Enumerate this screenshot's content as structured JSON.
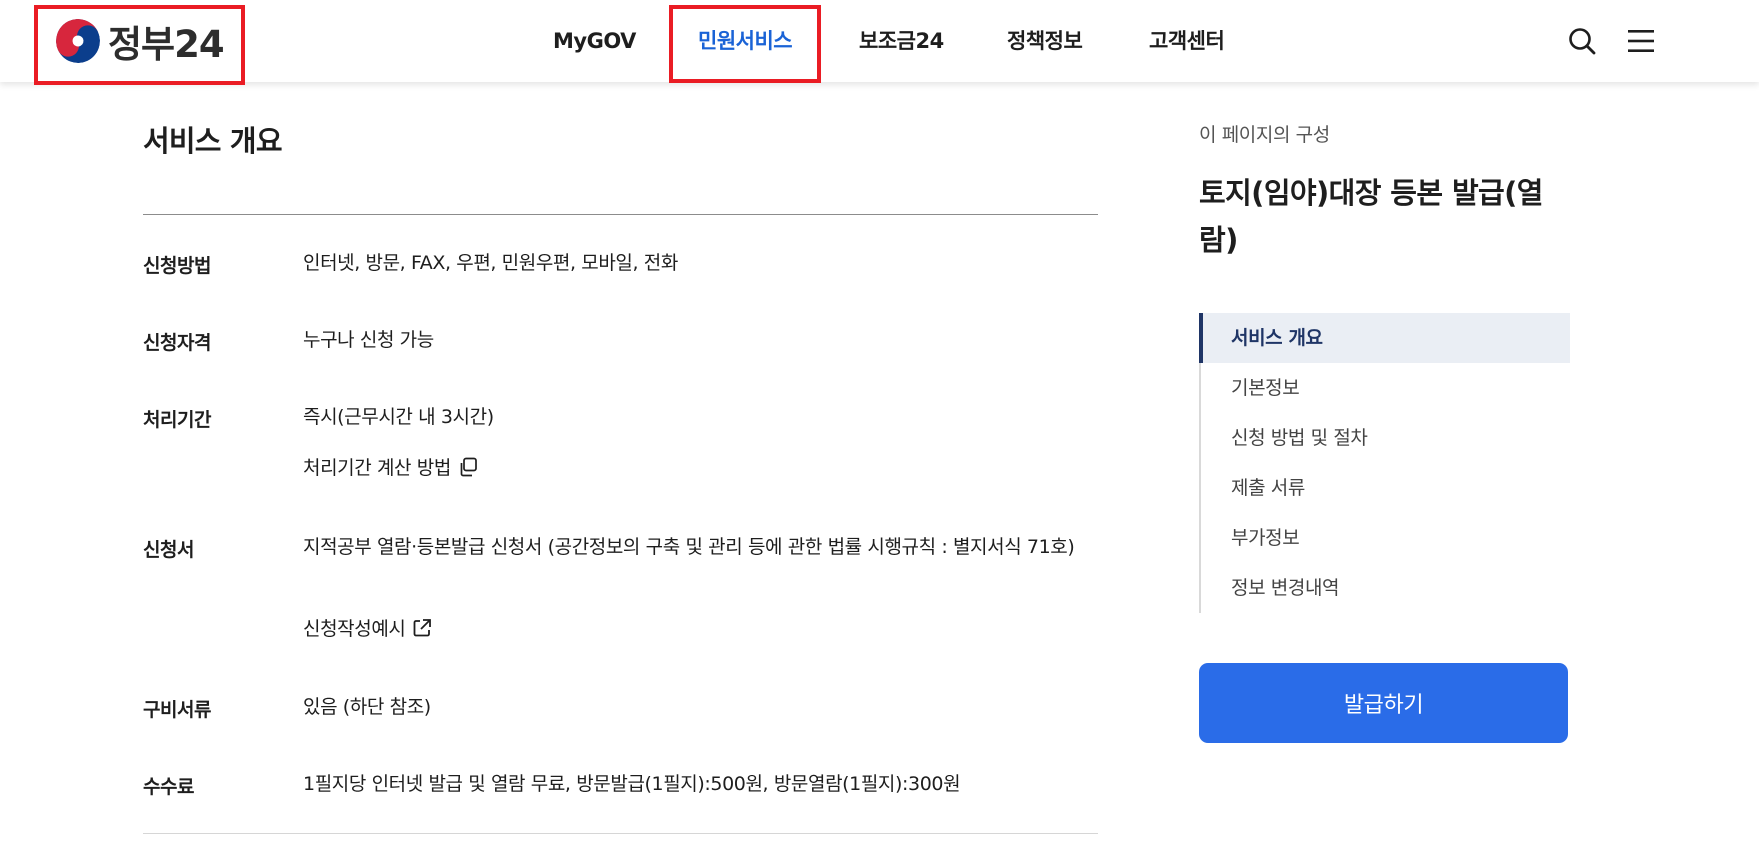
{
  "colors": {
    "accent": "#1a63d6",
    "button": "#2a6ce8",
    "highlight": "#ea1c24",
    "toc_active_bg": "#eaeef4",
    "toc_active_text": "#1f3566"
  },
  "header": {
    "logo_text": "정부24",
    "nav": [
      {
        "label": "MyGOV"
      },
      {
        "label": "민원서비스",
        "active": true
      },
      {
        "label": "보조금24"
      },
      {
        "label": "정책정보"
      },
      {
        "label": "고객센터"
      }
    ],
    "icons": [
      "search-icon",
      "menu-icon"
    ]
  },
  "main": {
    "section_title": "서비스 개요",
    "rows": [
      {
        "label": "신청방법",
        "value": "인터넷, 방문, FAX, 우편, 민원우편, 모바일, 전화"
      },
      {
        "label": "신청자격",
        "value": "누구나 신청 가능"
      },
      {
        "label": "처리기간",
        "value": "즉시(근무시간 내 3시간)",
        "link": "처리기간 계산 방법"
      },
      {
        "label": "신청서",
        "value": "지적공부 열람·등본발급 신청서 (공간정보의 구축 및 관리 등에 관한 법률 시행규칙 : 별지서식 71호)",
        "link": "신청작성예시"
      },
      {
        "label": "구비서류",
        "value": "있음 (하단 참조)"
      },
      {
        "label": "수수료",
        "value": "1필지당 인터넷 발급 및 열람 무료, 방문발급(1필지):500원, 방문열람(1필지):300원"
      }
    ]
  },
  "sidebar": {
    "caption": "이 페이지의 구성",
    "title": "토지(임야)대장 등본 발급(열람)",
    "toc": [
      {
        "label": "서비스 개요",
        "active": true
      },
      {
        "label": "기본정보"
      },
      {
        "label": "신청 방법 및 절차"
      },
      {
        "label": "제출 서류"
      },
      {
        "label": "부가정보"
      },
      {
        "label": "정보 변경내역"
      }
    ],
    "button_label": "발급하기"
  }
}
